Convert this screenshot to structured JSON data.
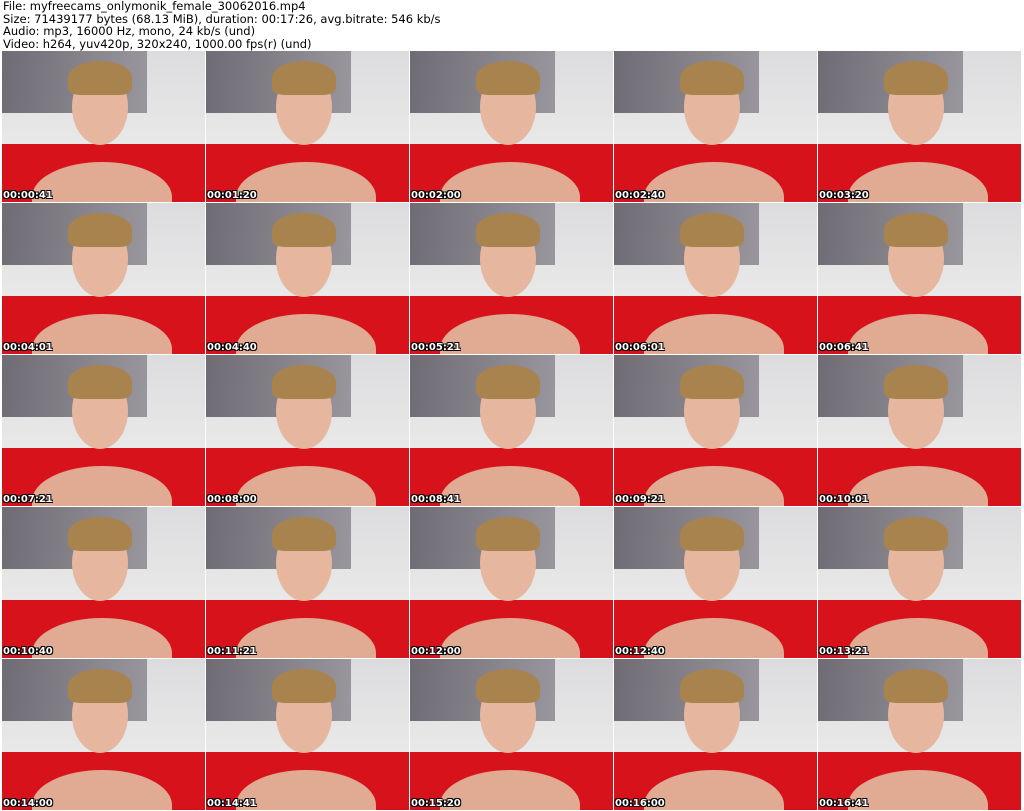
{
  "header": {
    "file": "File: myfreecams_onlymonik_female_30062016.mp4",
    "size": "Size: 71439177 bytes (68.13 MiB), duration: 00:17:26, avg.bitrate: 546 kb/s",
    "audio": "Audio: mp3, 16000 Hz, mono, 24 kb/s (und)",
    "video": "Video: h264, yuv420p, 320x240, 1000.00 fps(r) (und)"
  },
  "thumbnails": [
    "00:00:41",
    "00:01:20",
    "00:02:00",
    "00:02:40",
    "00:03:20",
    "00:04:01",
    "00:04:40",
    "00:05:21",
    "00:06:01",
    "00:06:41",
    "00:07:21",
    "00:08:00",
    "00:08:41",
    "00:09:21",
    "00:10:01",
    "00:10:40",
    "00:11:21",
    "00:12:00",
    "00:12:40",
    "00:13:21",
    "00:14:00",
    "00:14:41",
    "00:15:20",
    "00:16:00",
    "00:16:41"
  ]
}
